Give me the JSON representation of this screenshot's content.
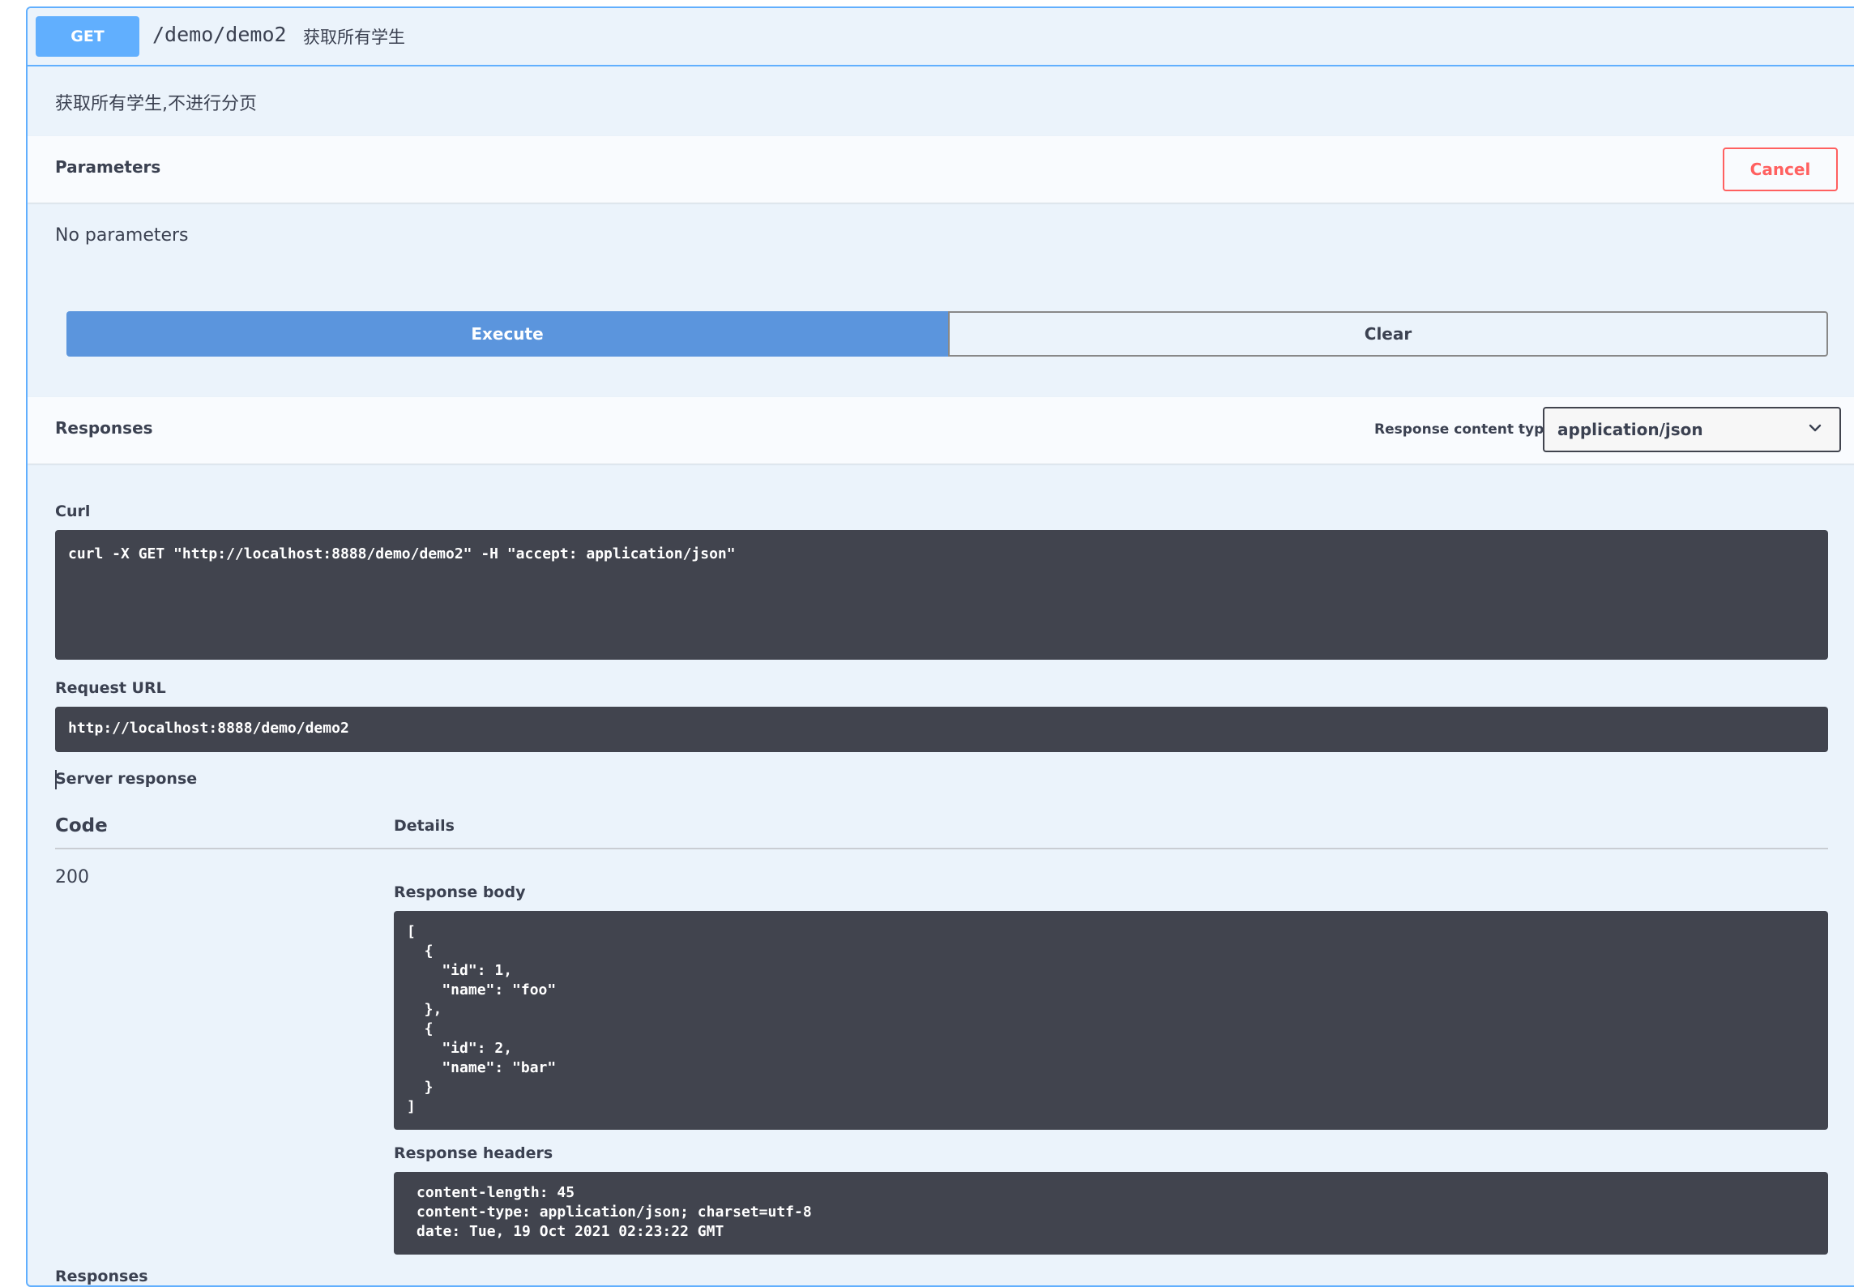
{
  "operation": {
    "method": "GET",
    "path": "/demo/demo2",
    "summary": "获取所有学生",
    "description": "获取所有学生,不进行分页"
  },
  "parameters": {
    "title": "Parameters",
    "cancel_label": "Cancel",
    "empty_text": "No parameters"
  },
  "actions": {
    "execute_label": "Execute",
    "clear_label": "Clear"
  },
  "responses": {
    "title": "Responses",
    "content_type_label": "Response content type",
    "content_type_value": "application/json"
  },
  "curl": {
    "label": "Curl",
    "command": "curl -X GET \"http://localhost:8888/demo/demo2\" -H \"accept: application/json\""
  },
  "request_url": {
    "label": "Request URL",
    "value": "http://localhost:8888/demo/demo2"
  },
  "server_response": {
    "label": "Server response",
    "code_header": "Code",
    "details_header": "Details",
    "code": "200",
    "body_label": "Response body",
    "body": "[\n  {\n    \"id\": 1,\n    \"name\": \"foo\"\n  },\n  {\n    \"id\": 2,\n    \"name\": \"bar\"\n  }\n]",
    "headers_label": "Response headers",
    "headers": "content-length: 45\ncontent-type: application/json; charset=utf-8\ndate: Tue, 19 Oct 2021 02:23:22 GMT"
  },
  "footer_label": "Responses",
  "colors": {
    "get_method": "#61affe",
    "execute": "#5b95dd",
    "cancel": "#ff6060",
    "code_bg": "#41444e",
    "panel_bg": "#ebf3fb"
  }
}
